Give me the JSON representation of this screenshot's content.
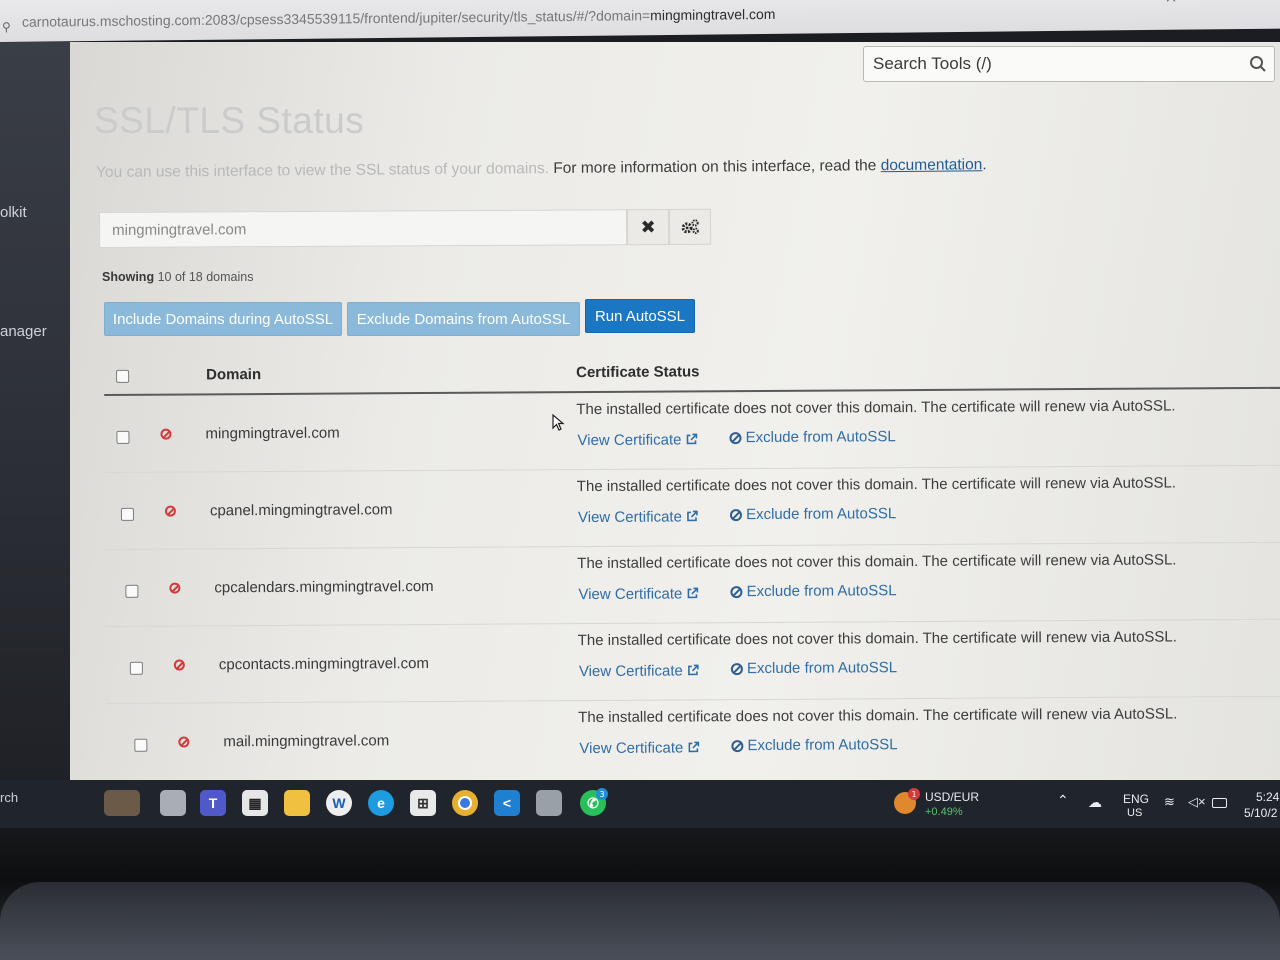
{
  "browser": {
    "url_muted": "carnotaurus.mschosting.com:2083/cpsess3345539115/frontend/jupiter/security/tls_status/#/?domain=",
    "url_domain": "mingmingtravel.com"
  },
  "sidebar": {
    "fragments": [
      "olkit",
      "anager"
    ]
  },
  "search_tools": {
    "placeholder": "Search Tools (/)"
  },
  "page": {
    "title": "SSL/TLS Status",
    "intro_faded": "You can use this interface to view the SSL status of your domains.",
    "intro_rest": " For more information on this interface, read the ",
    "intro_link": "documentation",
    "intro_end": "."
  },
  "filter": {
    "value": "mingmingtravel.com",
    "clear_label": "✖",
    "settings_icon": "gears-icon"
  },
  "showing": {
    "label": "Showing",
    "text": "10 of 18 domains"
  },
  "actions": {
    "include": "Include Domains during AutoSSL",
    "exclude": "Exclude Domains from AutoSSL",
    "run": "Run AutoSSL"
  },
  "table": {
    "headers": {
      "domain": "Domain",
      "status": "Certificate Status"
    },
    "rows": [
      {
        "domain": "mingmingtravel.com",
        "message": "The installed certificate does not cover this domain. The certificate will renew via AutoSSL.",
        "view": "View Certificate",
        "exclude": "Exclude from AutoSSL"
      },
      {
        "domain": "cpanel.mingmingtravel.com",
        "message": "The installed certificate does not cover this domain. The certificate will renew via AutoSSL.",
        "view": "View Certificate",
        "exclude": "Exclude from AutoSSL"
      },
      {
        "domain": "cpcalendars.mingmingtravel.com",
        "message": "The installed certificate does not cover this domain. The certificate will renew via AutoSSL.",
        "view": "View Certificate",
        "exclude": "Exclude from AutoSSL"
      },
      {
        "domain": "cpcontacts.mingmingtravel.com",
        "message": "The installed certificate does not cover this domain. The certificate will renew via AutoSSL.",
        "view": "View Certificate",
        "exclude": "Exclude from AutoSSL"
      },
      {
        "domain": "mail.mingmingtravel.com",
        "message": "The installed certificate does not cover this domain. The certificate will renew via AutoSSL.",
        "view": "View Certificate",
        "exclude": "Exclude from AutoSSL"
      }
    ]
  },
  "taskbar": {
    "search_fragment": "rch",
    "ticker_name": "USD/EUR",
    "ticker_change": "+0.49%",
    "ticker_badge": "1",
    "whatsapp_badge": "3",
    "lang_top": "ENG",
    "lang_bottom": "US",
    "time": "5:24",
    "date": "5/10/2",
    "colors": {
      "accent": "#1b77c4",
      "error": "#d43a3a",
      "up": "#57c26a"
    }
  }
}
